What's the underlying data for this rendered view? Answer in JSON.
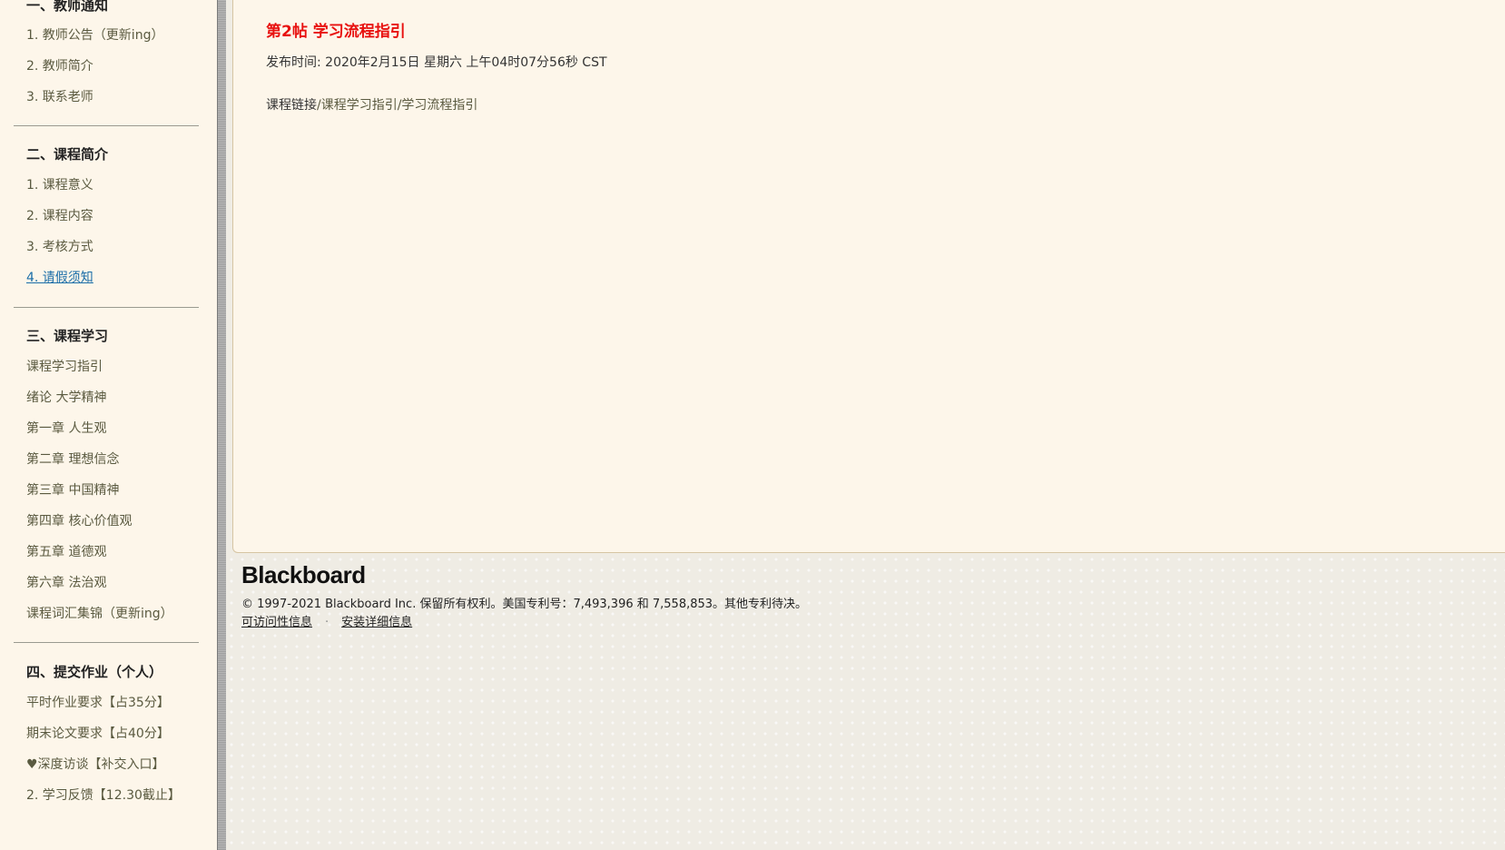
{
  "sidebar": {
    "sections": [
      {
        "heading": "一、教师通知",
        "items": [
          "1. 教师公告（更新ing）",
          "2. 教师简介",
          "3. 联系老师"
        ]
      },
      {
        "heading": "二、课程简介",
        "items": [
          "1. 课程意义",
          "2. 课程内容",
          "3. 考核方式",
          "4. 请假须知"
        ]
      },
      {
        "heading": "三、课程学习",
        "items": [
          "课程学习指引",
          "绪论 大学精神",
          "第一章 人生观",
          "第二章 理想信念",
          "第三章 中国精神",
          "第四章 核心价值观",
          "第五章 道德观",
          "第六章 法治观",
          "课程词汇集锦（更新ing）"
        ]
      },
      {
        "heading": "四、提交作业（个人）",
        "items": [
          "平时作业要求【占35分】",
          "期末论文要求【占40分】",
          "♥深度访谈【补交入口】",
          "2. 学习反馈【12.30截止】"
        ]
      }
    ],
    "active_item": "4. 请假须知"
  },
  "content": {
    "title": "第2帖 学习流程指引",
    "post_time": "发布时间: 2020年2月15日 星期六 上午04时07分56秒 CST",
    "course_link_label": "课程链接",
    "course_link_path": "/课程学习指引/学习流程指引"
  },
  "footer": {
    "logo": "Blackboard",
    "copyright": "© 1997-2021 Blackboard Inc. 保留所有权利。美国专利号：7,493,396 和 7,558,853。其他专利待决。",
    "links": [
      "可访问性信息",
      "安装详细信息"
    ],
    "separator": "·"
  },
  "colors": {
    "title_red": "#e8110f",
    "sidebar_bg": "#fdf6ea",
    "link_active": "#1b6ea8"
  }
}
